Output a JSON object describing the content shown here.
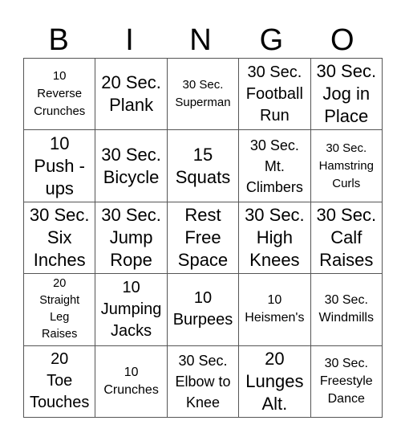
{
  "header": {
    "letters": [
      "B",
      "I",
      "N",
      "G",
      "O"
    ]
  },
  "board": {
    "rows": [
      [
        "10\nReverse\nCrunches",
        "20 Sec.\nPlank",
        "30 Sec.\nSuperman",
        "30 Sec.\nFootball\nRun",
        "30 Sec.\nJog in\nPlace"
      ],
      [
        "10\nPush -\nups",
        "30 Sec.\nBicycle",
        "15\nSquats",
        "30 Sec.\nMt.\nClimbers",
        "30 Sec.\nHamstring\nCurls"
      ],
      [
        "30 Sec.\nSix\nInches",
        "30 Sec.\nJump\nRope",
        "Rest\nFree\nSpace",
        "30 Sec.\nHigh\nKnees",
        "30 Sec.\nCalf\nRaises"
      ],
      [
        "20\nStraight\nLeg\nRaises",
        "10\nJumping\nJacks",
        "10\nBurpees",
        "10\nHeismen's",
        "30 Sec.\nWindmills"
      ],
      [
        "20\nToe\nTouches",
        "10\nCrunches",
        "30 Sec.\nElbow to\nKnee",
        "20\nLunges\nAlt.",
        "30 Sec.\nFreestyle\nDance"
      ]
    ]
  }
}
